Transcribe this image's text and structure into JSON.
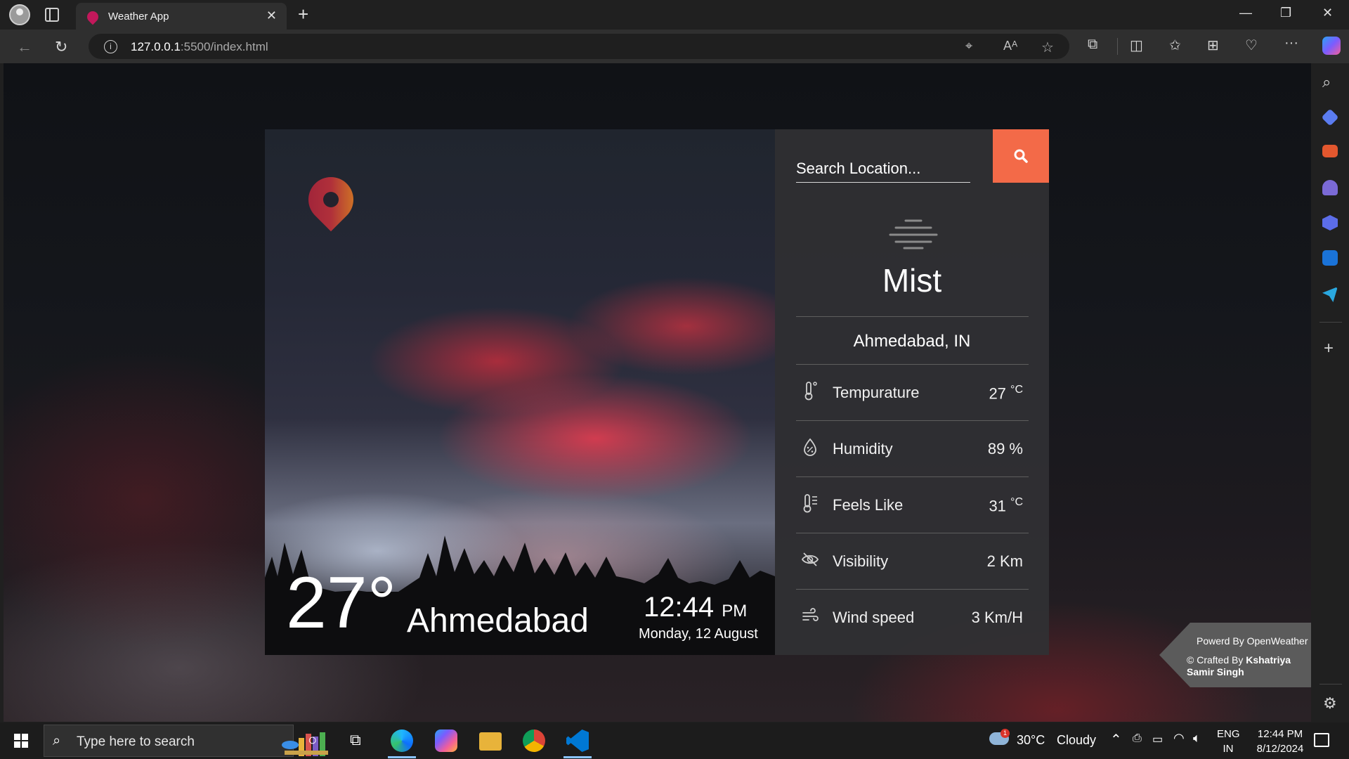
{
  "browser": {
    "tab_title": "Weather App",
    "tab_close": "✕",
    "new_tab": "+",
    "url_host": "127.0.0.1",
    "url_rest": ":5500/index.html",
    "window_controls": {
      "minimize": "—",
      "restore": "❐",
      "close": "✕"
    },
    "nav": {
      "back": "←",
      "reload": "↻"
    },
    "menu": "···"
  },
  "weather": {
    "logo_icon": "map-pin-icon",
    "search_placeholder": "Search Location...",
    "search_icon": "search-icon",
    "condition_icon": "mist-icon",
    "condition": "Mist",
    "location": "Ahmedabad, IN",
    "big_temp": "27°",
    "city": "Ahmedabad",
    "time": "12:44",
    "ampm": "PM",
    "date": "Monday, 12 August",
    "details": [
      {
        "icon": "thermometer-icon",
        "label": "Tempurature",
        "value": "27",
        "unit": "°C"
      },
      {
        "icon": "humidity-icon",
        "label": "Humidity",
        "value": "89 %",
        "unit": ""
      },
      {
        "icon": "feels-like-icon",
        "label": "Feels Like",
        "value": "31",
        "unit": "°C"
      },
      {
        "icon": "visibility-off-icon",
        "label": "Visibility",
        "value": "2 Km",
        "unit": ""
      },
      {
        "icon": "wind-icon",
        "label": "Wind speed",
        "value": "3 Km/H",
        "unit": ""
      }
    ],
    "accent_color": "#f36a48"
  },
  "credit": {
    "powered": "Powerd By OpenWeather",
    "crafted_prefix": "© Crafted By ",
    "author": "Kshatriya Samir Singh"
  },
  "taskbar": {
    "search_placeholder": "Type here to search",
    "weather_temp": "30°C",
    "weather_text": "Cloudy",
    "weather_badge": "1",
    "lang": "ENG",
    "region": "IN",
    "time": "12:44 PM",
    "date": "8/12/2024"
  }
}
